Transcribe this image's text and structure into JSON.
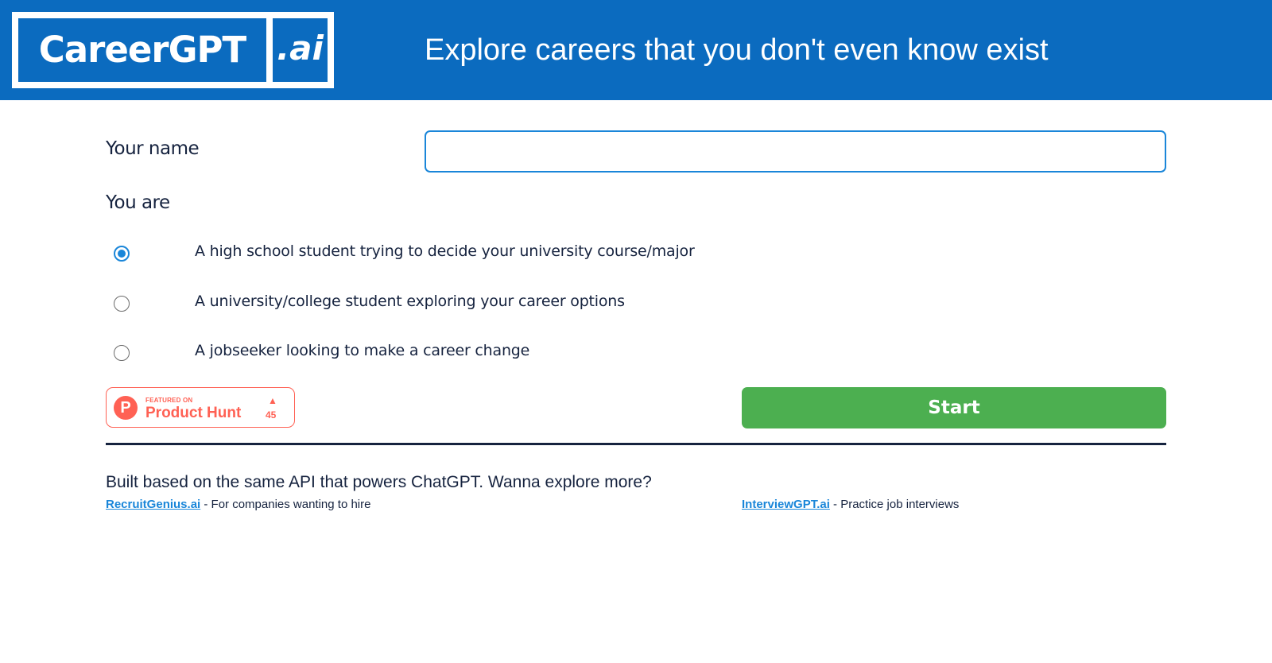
{
  "header": {
    "logo_main": "CareerGPT",
    "logo_ai": ".ai",
    "tagline": "Explore careers that you don't even know exist",
    "background_color": "#0b6bbf"
  },
  "form": {
    "name_label": "Your name",
    "name_value": "",
    "role_label": "You are",
    "options": [
      {
        "label": "A high school student trying to decide your university course/major",
        "selected": true
      },
      {
        "label": "A university/college student exploring your career options",
        "selected": false
      },
      {
        "label": "A jobseeker looking to make a career change",
        "selected": false
      }
    ]
  },
  "product_hunt": {
    "small_text": "FEATURED ON",
    "name": "Product Hunt",
    "letter": "P",
    "upvote_icon": "triangle-up-icon",
    "count": "45",
    "color": "#ff6154"
  },
  "actions": {
    "start_label": "Start",
    "start_color": "#4caf50"
  },
  "footer": {
    "text": "Built based on the same API that powers ChatGPT. Wanna explore more?",
    "links": [
      {
        "name": "RecruitGenius.ai",
        "description": " - For companies wanting to hire"
      },
      {
        "name": "InterviewGPT.ai",
        "description": " - Practice job interviews"
      }
    ]
  }
}
